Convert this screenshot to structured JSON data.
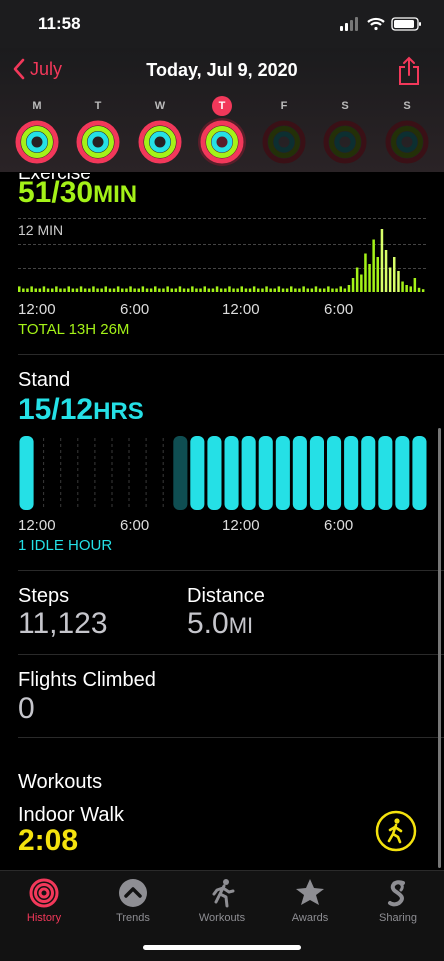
{
  "status_bar": {
    "time": "11:58"
  },
  "header": {
    "back_label": "July",
    "title": "Today, Jul 9, 2020"
  },
  "week": {
    "days": [
      "M",
      "T",
      "W",
      "T",
      "F",
      "S",
      "S"
    ],
    "selected_index": 3,
    "rings_active": [
      true,
      true,
      true,
      true,
      false,
      false,
      false
    ]
  },
  "exercise": {
    "label": "Exercise",
    "value": "51/30",
    "unit": "MIN",
    "max_label": "12 MIN",
    "ticks": [
      "12:00",
      "6:00",
      "12:00",
      "6:00"
    ],
    "total": "TOTAL 13H 26M",
    "color": "#a4f218"
  },
  "stand": {
    "label": "Stand",
    "value": "15/12",
    "unit": "HRS",
    "hours_stood": [
      true,
      false,
      false,
      false,
      false,
      false,
      false,
      false,
      false,
      true,
      true,
      true,
      true,
      true,
      true,
      true,
      true,
      true,
      true,
      true,
      true,
      true,
      true,
      true
    ],
    "idle_hours": [
      9
    ],
    "ticks": [
      "12:00",
      "6:00",
      "12:00",
      "6:00"
    ],
    "idle": "1 IDLE HOUR",
    "color": "#25e0e6"
  },
  "steps": {
    "label": "Steps",
    "value": "11,123"
  },
  "distance": {
    "label": "Distance",
    "value": "5.0",
    "unit": "MI"
  },
  "flights": {
    "label": "Flights Climbed",
    "value": "0"
  },
  "workouts": {
    "label": "Workouts",
    "name": "Indoor Walk",
    "duration": "2:08",
    "color": "#f4e20e"
  },
  "tabs": [
    {
      "label": "History",
      "icon": "rings-icon",
      "active": true
    },
    {
      "label": "Trends",
      "icon": "chevron-up-icon",
      "active": false
    },
    {
      "label": "Workouts",
      "icon": "runner-icon",
      "active": false
    },
    {
      "label": "Awards",
      "icon": "star-icon",
      "active": false
    },
    {
      "label": "Sharing",
      "icon": "sharing-icon",
      "active": false
    }
  ],
  "colors": {
    "accent": "#f2385a",
    "move": "#f2385a",
    "exercise": "#a4f218",
    "stand": "#25e0e6"
  }
}
